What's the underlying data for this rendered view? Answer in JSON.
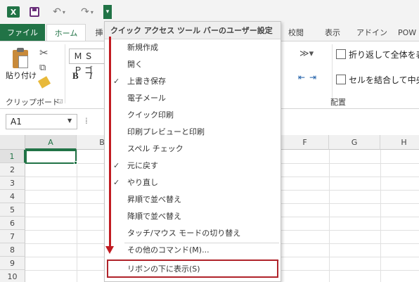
{
  "app_icon": "X",
  "qat": {
    "undo_glyph": "↶",
    "redo_glyph": "↷",
    "dropdown_glyph": "▾",
    "customize_glyph": "▾"
  },
  "tabs": [
    {
      "label": "ファイル"
    },
    {
      "label": "ホーム"
    },
    {
      "label": "挿"
    },
    {
      "label": "校閲"
    },
    {
      "label": "表示"
    },
    {
      "label": "アドイン"
    },
    {
      "label": "POW"
    }
  ],
  "ribbon": {
    "paste_label": "貼り付け",
    "clipboard_group": "クリップボード",
    "font_name": "ＭＳ Ｐゴ",
    "bold": "B",
    "italic": "I",
    "wrap_text": "折り返して全体を表示",
    "merge_center": "セルを結合して中央揃",
    "alignment_group": "配置"
  },
  "formula_bar": {
    "name_box": "A1",
    "dots": "⁞"
  },
  "grid": {
    "columns": [
      "A",
      "B",
      "F",
      "G",
      "H"
    ],
    "rows": [
      "1",
      "2",
      "3",
      "4",
      "5",
      "6",
      "7",
      "8",
      "9",
      "10"
    ],
    "active_column": "A",
    "active_row": "1"
  },
  "menu": {
    "header": "クイック アクセス ツール バーのユーザー設定",
    "items": [
      {
        "label": "新規作成",
        "checked": false
      },
      {
        "label": "開く",
        "checked": false
      },
      {
        "label": "上書き保存",
        "checked": true
      },
      {
        "label": "電子メール",
        "checked": false
      },
      {
        "label": "クイック印刷",
        "checked": false
      },
      {
        "label": "印刷プレビューと印刷",
        "checked": false
      },
      {
        "label": "スペル チェック",
        "checked": false
      },
      {
        "label": "元に戻す",
        "checked": true
      },
      {
        "label": "やり直し",
        "checked": true
      },
      {
        "label": "昇順で並べ替え",
        "checked": false
      },
      {
        "label": "降順で並べ替え",
        "checked": false
      },
      {
        "label": "タッチ/マウス モードの切り替え",
        "checked": false
      }
    ],
    "more_commands": "その他のコマンド(M)...",
    "show_below_ribbon": "リボンの下に表示(S)",
    "check_glyph": "✓"
  },
  "colors": {
    "excel_green": "#217346",
    "annotation_red": "#c11b21"
  }
}
